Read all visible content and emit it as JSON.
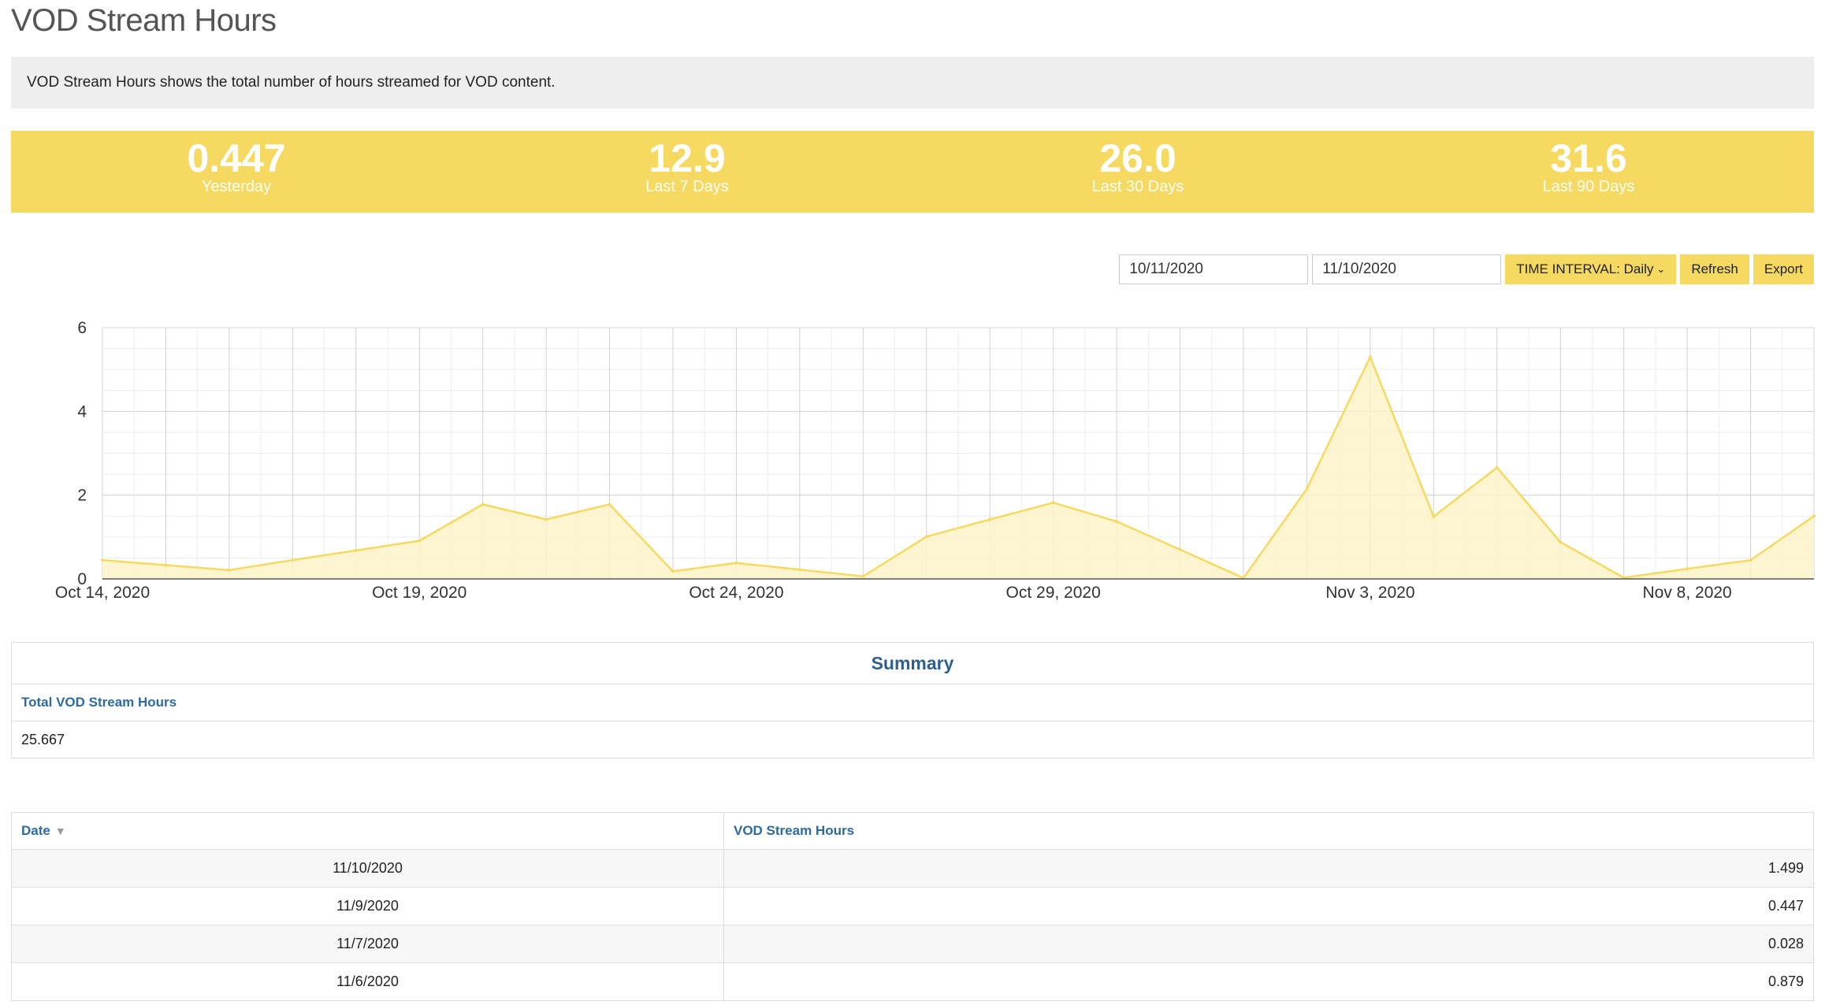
{
  "page": {
    "title": "VOD Stream Hours",
    "description": "VOD Stream Hours shows the total number of hours streamed for VOD content."
  },
  "stats": [
    {
      "value": "0.447",
      "label": "Yesterday"
    },
    {
      "value": "12.9",
      "label": "Last 7 Days"
    },
    {
      "value": "26.0",
      "label": "Last 30 Days"
    },
    {
      "value": "31.6",
      "label": "Last 90 Days"
    }
  ],
  "controls": {
    "start_date": "10/11/2020",
    "end_date": "11/10/2020",
    "interval_label": "TIME INTERVAL: Daily",
    "refresh_label": "Refresh",
    "export_label": "Export"
  },
  "colors": {
    "accent": "#f5d961",
    "line": "#f5d961",
    "area": "#fdf3c8",
    "link": "#2d6a9f"
  },
  "icons": {
    "interval_dropdown": "chevron-down-icon",
    "sort": "sort-down-icon"
  },
  "chart_data": {
    "type": "area",
    "x": [
      "2020-10-14",
      "2020-10-15",
      "2020-10-16",
      "2020-10-17",
      "2020-10-18",
      "2020-10-19",
      "2020-10-20",
      "2020-10-21",
      "2020-10-22",
      "2020-10-23",
      "2020-10-24",
      "2020-10-25",
      "2020-10-26",
      "2020-10-27",
      "2020-10-28",
      "2020-10-29",
      "2020-10-30",
      "2020-10-31",
      "2020-11-01",
      "2020-11-02",
      "2020-11-03",
      "2020-11-04",
      "2020-11-05",
      "2020-11-06",
      "2020-11-07",
      "2020-11-08",
      "2020-11-09",
      "2020-11-10"
    ],
    "values": [
      0.45,
      0.33,
      0.21,
      0.45,
      0.68,
      0.91,
      1.78,
      1.42,
      1.78,
      0.18,
      0.38,
      0.22,
      0.06,
      1.01,
      1.42,
      1.82,
      1.37,
      0.7,
      0.02,
      2.15,
      5.3,
      1.49,
      2.66,
      0.879,
      0.028,
      0.24,
      0.447,
      1.499
    ],
    "tick_labels": [
      "Oct 14, 2020",
      "Oct 19, 2020",
      "Oct 24, 2020",
      "Oct 29, 2020",
      "Nov 3, 2020",
      "Nov 8, 2020"
    ],
    "tick_index": [
      0,
      5,
      10,
      15,
      20,
      25
    ],
    "y_ticks": [
      "0",
      "2",
      "4",
      "6"
    ],
    "ylim": [
      0,
      6
    ],
    "grid": true,
    "legend": "none",
    "title": "",
    "xlabel": "",
    "ylabel": ""
  },
  "summary": {
    "title": "Summary",
    "label": "Total VOD Stream Hours",
    "value": "25.667"
  },
  "table": {
    "headers": [
      "Date",
      "VOD Stream Hours"
    ],
    "rows": [
      {
        "date": "11/10/2020",
        "hours": "1.499"
      },
      {
        "date": "11/9/2020",
        "hours": "0.447"
      },
      {
        "date": "11/7/2020",
        "hours": "0.028"
      },
      {
        "date": "11/6/2020",
        "hours": "0.879"
      }
    ]
  }
}
